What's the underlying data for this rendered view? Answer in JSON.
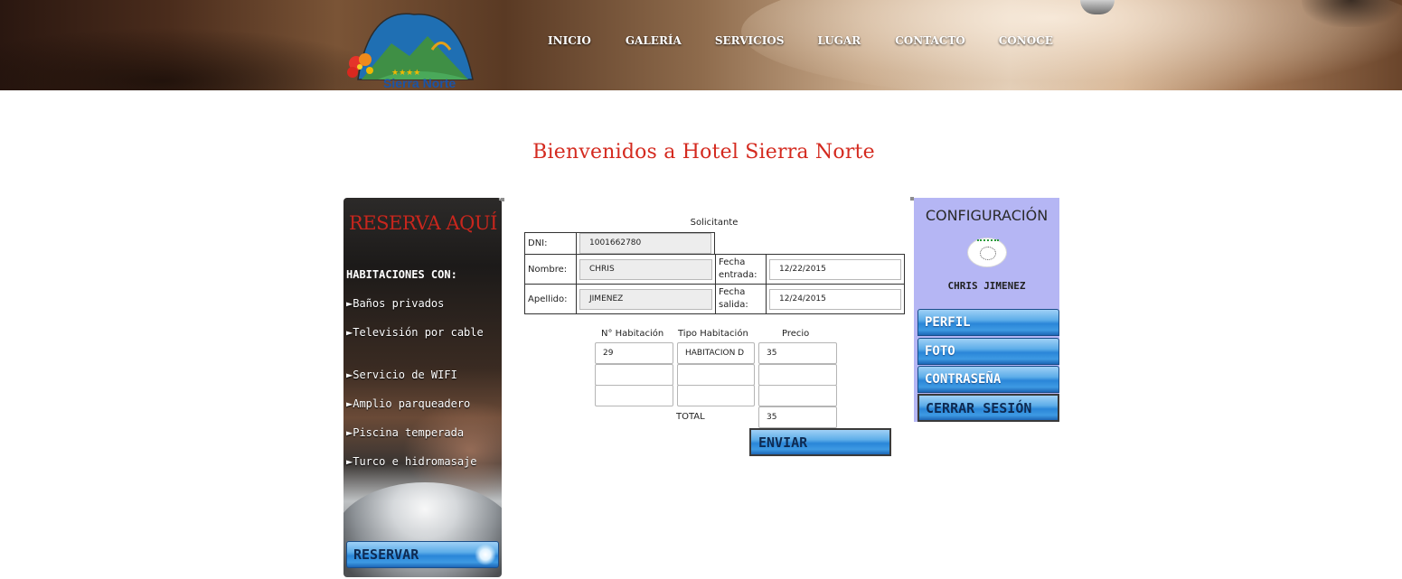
{
  "header": {
    "logo_text": "Sierra Norte",
    "nav": [
      "INICIO",
      "GALERÍA",
      "SERVICIOS",
      "LUGAR",
      "CONTACTO",
      "CONOCE"
    ]
  },
  "welcome_title": "Bienvenidos a Hotel Sierra Norte",
  "left_panel": {
    "title": "RESERVA AQUÍ",
    "heading": "HABITACIONES CON:",
    "features": [
      "►Baños privados",
      "►Televisión por cable",
      "►Servicio de WIFI",
      "►Amplio parqueadero",
      "►Piscina temperada",
      "►Turco e hidromasaje"
    ],
    "reserve_button": "RESERVAR"
  },
  "form": {
    "section_label": "Solicitante",
    "dni_label": "DNI:",
    "dni_value": "1001662780",
    "nombre_label": "Nombre:",
    "nombre_value": "CHRIS",
    "apellido_label": "Apellido:",
    "apellido_value": "JIMENEZ",
    "fecha_entrada_label": "Fecha entrada:",
    "fecha_entrada_value": "12/22/2015",
    "fecha_salida_label": "Fecha salida:",
    "fecha_salida_value": "12/24/2015",
    "rooms": {
      "headers": [
        "N° Habitación",
        "Tipo Habitación",
        "Precio"
      ],
      "rows": [
        [
          "29",
          "HABITACION D",
          "35"
        ],
        [
          "",
          "",
          ""
        ],
        [
          "",
          "",
          ""
        ]
      ],
      "total_label": "TOTAL",
      "total_value": "35"
    },
    "submit_button": "ENVIAR"
  },
  "right_panel": {
    "title": "CONFIGURACIÓN",
    "user_name": "CHRIS JIMENEZ",
    "menu": [
      "PERFIL",
      "FOTO",
      "CONTRASEÑA"
    ],
    "logout_button": "CERRAR SESIÓN"
  },
  "colors": {
    "title_red": "#d42a1f",
    "config_panel_bg": "#b5b6f4",
    "button_blue": "#2a86d8"
  }
}
